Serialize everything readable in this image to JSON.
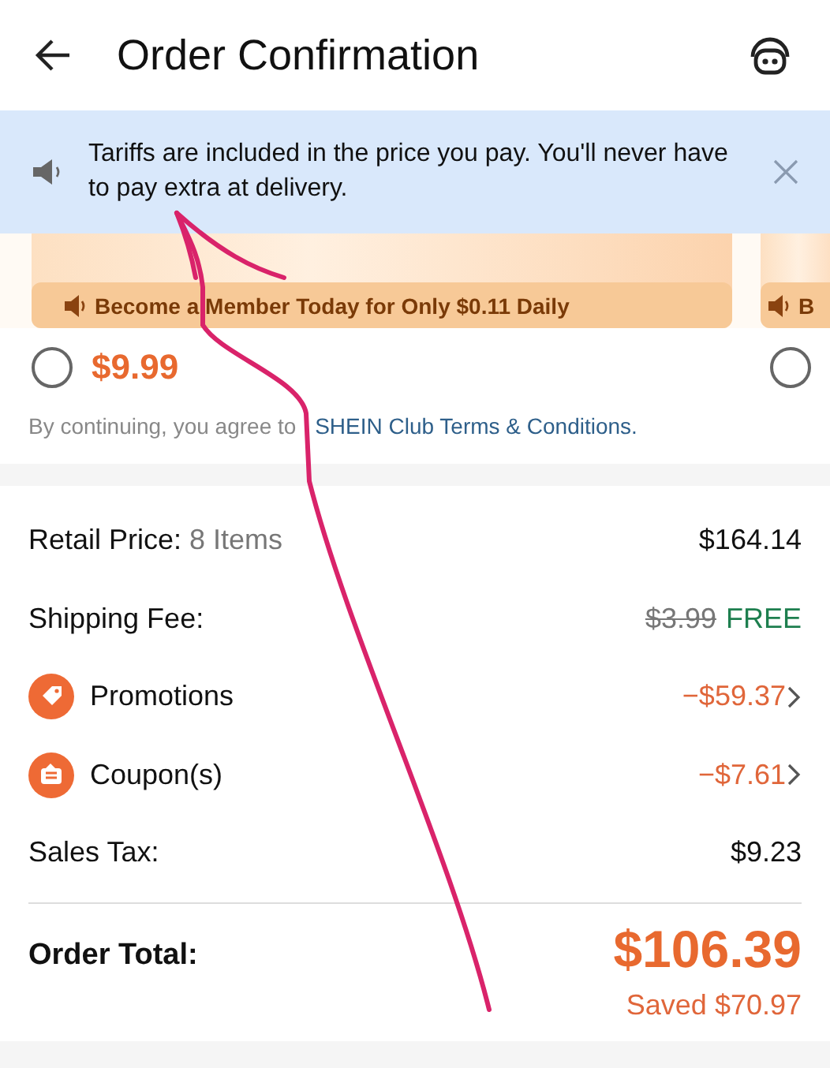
{
  "header": {
    "title": "Order Confirmation"
  },
  "notice": {
    "text": "Tariffs are included in the price you pay. You'll never have to pay extra at delivery."
  },
  "club_plans": [
    {
      "member_note": "Become a Member Today for Only $0.11 Daily",
      "price": "$9.99",
      "selected": false
    },
    {
      "member_note": "B",
      "selected": false
    }
  ],
  "terms": {
    "text": "By continuing, you agree to",
    "link": "SHEIN Club Terms & Conditions."
  },
  "summary": [
    {
      "kind": "plain",
      "label": "Retail Price:",
      "detail": "8 Items",
      "value": "$164.14"
    },
    {
      "kind": "shipping",
      "label": "Shipping Fee:",
      "old_value": "$3.99",
      "value": "FREE"
    },
    {
      "kind": "promotion",
      "label": "Promotions",
      "value": "−$59.37"
    },
    {
      "kind": "coupon",
      "label": "Coupon(s)",
      "value": "−$7.61"
    },
    {
      "kind": "plain",
      "label": "Sales Tax:",
      "value": "$9.23"
    }
  ],
  "total": {
    "label": "Order Total:",
    "value": "$106.39",
    "saved": "Saved $70.97"
  }
}
